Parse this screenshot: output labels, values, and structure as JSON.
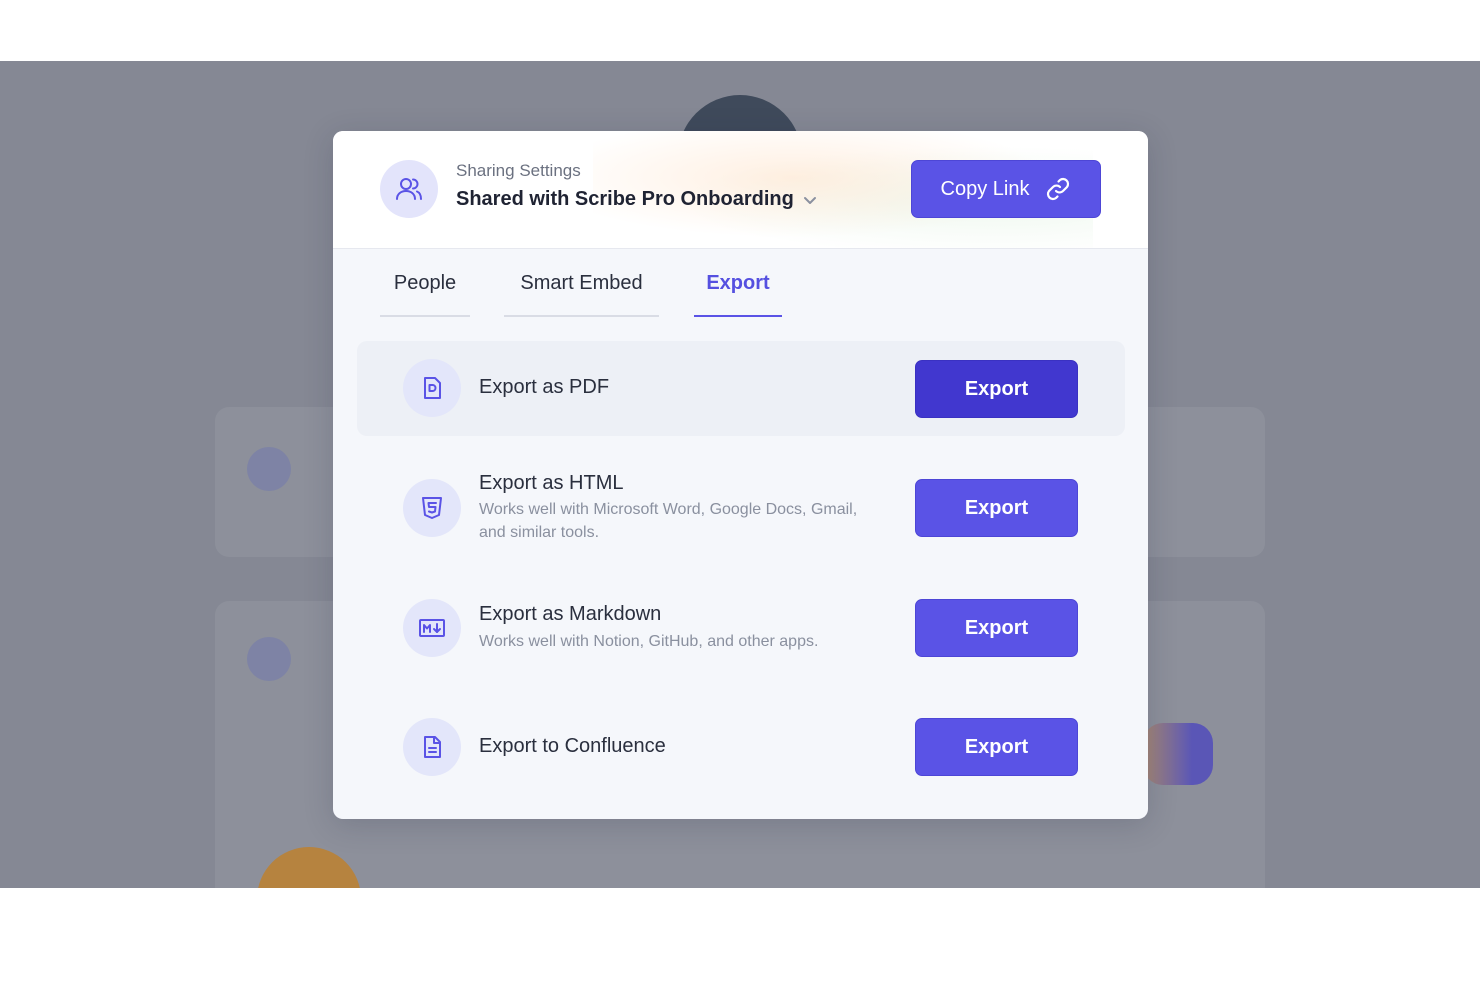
{
  "header": {
    "subtitle": "Sharing Settings",
    "title": "Shared with Scribe Pro Onboarding",
    "copy_link_label": "Copy Link"
  },
  "tabs": [
    {
      "label": "People",
      "active": false
    },
    {
      "label": "Smart Embed",
      "active": false
    },
    {
      "label": "Export",
      "active": true
    }
  ],
  "exports": [
    {
      "title": "Export as PDF",
      "description": "",
      "icon": "pdf-file-icon",
      "button": "Export"
    },
    {
      "title": "Export as HTML",
      "description": "Works well with Microsoft Word, Google Docs, Gmail, and similar tools.",
      "icon": "html5-icon",
      "button": "Export"
    },
    {
      "title": "Export as Markdown",
      "description": "Works well with Notion, GitHub, and other apps.",
      "icon": "markdown-icon",
      "button": "Export"
    },
    {
      "title": "Export to Confluence",
      "description": "",
      "icon": "document-icon",
      "button": "Export"
    }
  ],
  "colors": {
    "accent": "#5a53e6",
    "accent_dark": "#4137cf",
    "icon_bg": "#e3e6fa",
    "overlay": "#858894"
  }
}
